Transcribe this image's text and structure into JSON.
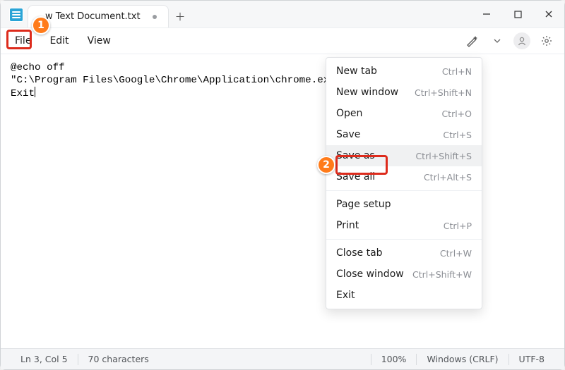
{
  "tab": {
    "title": "w Text Document.txt"
  },
  "menubar": {
    "file": "File",
    "edit": "Edit",
    "view": "View"
  },
  "editor": {
    "line1": "@echo off",
    "line2": "\"C:\\Program Files\\Google\\Chrome\\Application\\chrome.exe\"",
    "line3": "Exit"
  },
  "dropdown": {
    "new_tab": {
      "label": "New tab",
      "shortcut": "Ctrl+N"
    },
    "new_window": {
      "label": "New window",
      "shortcut": "Ctrl+Shift+N"
    },
    "open": {
      "label": "Open",
      "shortcut": "Ctrl+O"
    },
    "save": {
      "label": "Save",
      "shortcut": "Ctrl+S"
    },
    "save_as": {
      "label": "Save as",
      "shortcut": "Ctrl+Shift+S"
    },
    "save_all": {
      "label": "Save all",
      "shortcut": "Ctrl+Alt+S"
    },
    "page_setup": {
      "label": "Page setup",
      "shortcut": ""
    },
    "print": {
      "label": "Print",
      "shortcut": "Ctrl+P"
    },
    "close_tab": {
      "label": "Close tab",
      "shortcut": "Ctrl+W"
    },
    "close_window": {
      "label": "Close window",
      "shortcut": "Ctrl+Shift+W"
    },
    "exit": {
      "label": "Exit",
      "shortcut": ""
    }
  },
  "annotations": {
    "step1": "1",
    "step2": "2"
  },
  "status": {
    "cursor": "Ln 3, Col 5",
    "chars": "70 characters",
    "zoom": "100%",
    "line_ending": "Windows (CRLF)",
    "encoding": "UTF-8"
  }
}
